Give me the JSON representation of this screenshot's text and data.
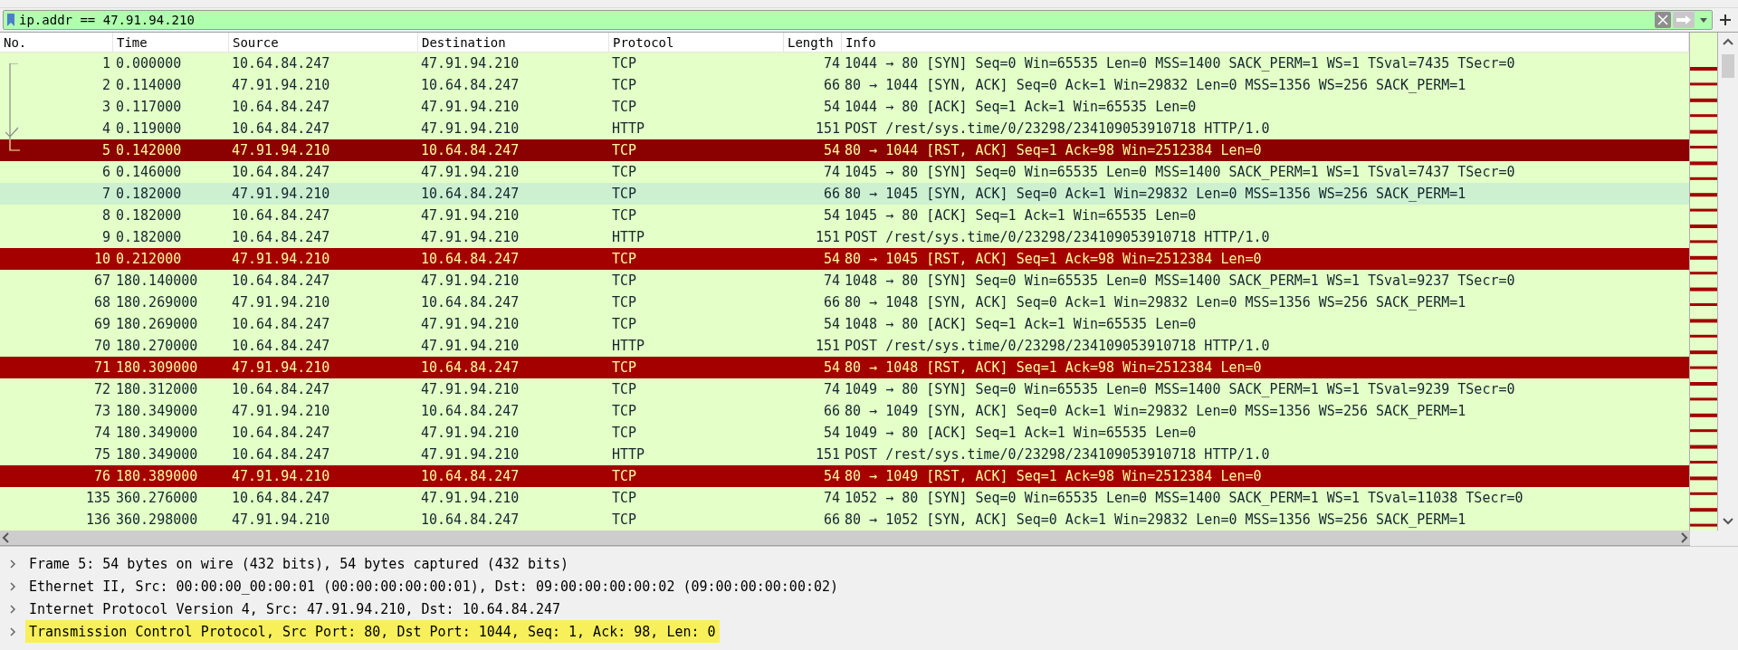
{
  "filter": {
    "value": "ip.addr == 47.91.94.210",
    "valid": true
  },
  "columns": [
    "No.",
    "Time",
    "Source",
    "Destination",
    "Protocol",
    "Length",
    "Info"
  ],
  "rows": [
    {
      "no": "1",
      "time": "0.000000",
      "source": "10.64.84.247",
      "destination": "47.91.94.210",
      "protocol": "TCP",
      "length": "74",
      "info": "1044 → 80 [SYN] Seq=0 Win=65535 Len=0 MSS=1400 SACK_PERM=1 WS=1 TSval=7435 TSecr=0",
      "kind": "normal",
      "selected": false,
      "hovered": false,
      "related": true,
      "request": false
    },
    {
      "no": "2",
      "time": "0.114000",
      "source": "47.91.94.210",
      "destination": "10.64.84.247",
      "protocol": "TCP",
      "length": "66",
      "info": "80 → 1044 [SYN, ACK] Seq=0 Ack=1 Win=29832 Len=0 MSS=1356 WS=256 SACK_PERM=1",
      "kind": "normal",
      "selected": false,
      "hovered": false,
      "related": true,
      "request": false
    },
    {
      "no": "3",
      "time": "0.117000",
      "source": "10.64.84.247",
      "destination": "47.91.94.210",
      "protocol": "TCP",
      "length": "54",
      "info": "1044 → 80 [ACK] Seq=1 Ack=1 Win=65535 Len=0",
      "kind": "normal",
      "selected": false,
      "hovered": false,
      "related": true,
      "request": false
    },
    {
      "no": "4",
      "time": "0.119000",
      "source": "10.64.84.247",
      "destination": "47.91.94.210",
      "protocol": "HTTP",
      "length": "151",
      "info": "POST /rest/sys.time/0/23298/234109053910718 HTTP/1.0",
      "kind": "normal",
      "selected": false,
      "hovered": false,
      "related": true,
      "request": true
    },
    {
      "no": "5",
      "time": "0.142000",
      "source": "47.91.94.210",
      "destination": "10.64.84.247",
      "protocol": "TCP",
      "length": "54",
      "info": "80 → 1044 [RST, ACK] Seq=1 Ack=98 Win=2512384 Len=0",
      "kind": "error",
      "selected": true,
      "hovered": false,
      "related": true,
      "request": false
    },
    {
      "no": "6",
      "time": "0.146000",
      "source": "10.64.84.247",
      "destination": "47.91.94.210",
      "protocol": "TCP",
      "length": "74",
      "info": "1045 → 80 [SYN] Seq=0 Win=65535 Len=0 MSS=1400 SACK_PERM=1 WS=1 TSval=7437 TSecr=0",
      "kind": "normal",
      "selected": false,
      "hovered": false,
      "related": false,
      "request": false
    },
    {
      "no": "7",
      "time": "0.182000",
      "source": "47.91.94.210",
      "destination": "10.64.84.247",
      "protocol": "TCP",
      "length": "66",
      "info": "80 → 1045 [SYN, ACK] Seq=0 Ack=1 Win=29832 Len=0 MSS=1356 WS=256 SACK_PERM=1",
      "kind": "normal",
      "selected": false,
      "hovered": true,
      "related": false,
      "request": false
    },
    {
      "no": "8",
      "time": "0.182000",
      "source": "10.64.84.247",
      "destination": "47.91.94.210",
      "protocol": "TCP",
      "length": "54",
      "info": "1045 → 80 [ACK] Seq=1 Ack=1 Win=65535 Len=0",
      "kind": "normal",
      "selected": false,
      "hovered": false,
      "related": false,
      "request": false
    },
    {
      "no": "9",
      "time": "0.182000",
      "source": "10.64.84.247",
      "destination": "47.91.94.210",
      "protocol": "HTTP",
      "length": "151",
      "info": "POST /rest/sys.time/0/23298/234109053910718 HTTP/1.0",
      "kind": "normal",
      "selected": false,
      "hovered": false,
      "related": false,
      "request": false
    },
    {
      "no": "10",
      "time": "0.212000",
      "source": "47.91.94.210",
      "destination": "10.64.84.247",
      "protocol": "TCP",
      "length": "54",
      "info": "80 → 1045 [RST, ACK] Seq=1 Ack=98 Win=2512384 Len=0",
      "kind": "error",
      "selected": false,
      "hovered": false,
      "related": false,
      "request": false
    },
    {
      "no": "67",
      "time": "180.140000",
      "source": "10.64.84.247",
      "destination": "47.91.94.210",
      "protocol": "TCP",
      "length": "74",
      "info": "1048 → 80 [SYN] Seq=0 Win=65535 Len=0 MSS=1400 SACK_PERM=1 WS=1 TSval=9237 TSecr=0",
      "kind": "normal",
      "selected": false,
      "hovered": false,
      "related": false,
      "request": false
    },
    {
      "no": "68",
      "time": "180.269000",
      "source": "47.91.94.210",
      "destination": "10.64.84.247",
      "protocol": "TCP",
      "length": "66",
      "info": "80 → 1048 [SYN, ACK] Seq=0 Ack=1 Win=29832 Len=0 MSS=1356 WS=256 SACK_PERM=1",
      "kind": "normal",
      "selected": false,
      "hovered": false,
      "related": false,
      "request": false
    },
    {
      "no": "69",
      "time": "180.269000",
      "source": "10.64.84.247",
      "destination": "47.91.94.210",
      "protocol": "TCP",
      "length": "54",
      "info": "1048 → 80 [ACK] Seq=1 Ack=1 Win=65535 Len=0",
      "kind": "normal",
      "selected": false,
      "hovered": false,
      "related": false,
      "request": false
    },
    {
      "no": "70",
      "time": "180.270000",
      "source": "10.64.84.247",
      "destination": "47.91.94.210",
      "protocol": "HTTP",
      "length": "151",
      "info": "POST /rest/sys.time/0/23298/234109053910718 HTTP/1.0",
      "kind": "normal",
      "selected": false,
      "hovered": false,
      "related": false,
      "request": false
    },
    {
      "no": "71",
      "time": "180.309000",
      "source": "47.91.94.210",
      "destination": "10.64.84.247",
      "protocol": "TCP",
      "length": "54",
      "info": "80 → 1048 [RST, ACK] Seq=1 Ack=98 Win=2512384 Len=0",
      "kind": "error",
      "selected": false,
      "hovered": false,
      "related": false,
      "request": false
    },
    {
      "no": "72",
      "time": "180.312000",
      "source": "10.64.84.247",
      "destination": "47.91.94.210",
      "protocol": "TCP",
      "length": "74",
      "info": "1049 → 80 [SYN] Seq=0 Win=65535 Len=0 MSS=1400 SACK_PERM=1 WS=1 TSval=9239 TSecr=0",
      "kind": "normal",
      "selected": false,
      "hovered": false,
      "related": false,
      "request": false
    },
    {
      "no": "73",
      "time": "180.349000",
      "source": "47.91.94.210",
      "destination": "10.64.84.247",
      "protocol": "TCP",
      "length": "66",
      "info": "80 → 1049 [SYN, ACK] Seq=0 Ack=1 Win=29832 Len=0 MSS=1356 WS=256 SACK_PERM=1",
      "kind": "normal",
      "selected": false,
      "hovered": false,
      "related": false,
      "request": false
    },
    {
      "no": "74",
      "time": "180.349000",
      "source": "10.64.84.247",
      "destination": "47.91.94.210",
      "protocol": "TCP",
      "length": "54",
      "info": "1049 → 80 [ACK] Seq=1 Ack=1 Win=65535 Len=0",
      "kind": "normal",
      "selected": false,
      "hovered": false,
      "related": false,
      "request": false
    },
    {
      "no": "75",
      "time": "180.349000",
      "source": "10.64.84.247",
      "destination": "47.91.94.210",
      "protocol": "HTTP",
      "length": "151",
      "info": "POST /rest/sys.time/0/23298/234109053910718 HTTP/1.0",
      "kind": "normal",
      "selected": false,
      "hovered": false,
      "related": false,
      "request": false
    },
    {
      "no": "76",
      "time": "180.389000",
      "source": "47.91.94.210",
      "destination": "10.64.84.247",
      "protocol": "TCP",
      "length": "54",
      "info": "80 → 1049 [RST, ACK] Seq=1 Ack=98 Win=2512384 Len=0",
      "kind": "error",
      "selected": false,
      "hovered": false,
      "related": false,
      "request": false
    },
    {
      "no": "135",
      "time": "360.276000",
      "source": "10.64.84.247",
      "destination": "47.91.94.210",
      "protocol": "TCP",
      "length": "74",
      "info": "1052 → 80 [SYN] Seq=0 Win=65535 Len=0 MSS=1400 SACK_PERM=1 WS=1 TSval=11038 TSecr=0",
      "kind": "normal",
      "selected": false,
      "hovered": false,
      "related": false,
      "request": false
    },
    {
      "no": "136",
      "time": "360.298000",
      "source": "47.91.94.210",
      "destination": "10.64.84.247",
      "protocol": "TCP",
      "length": "66",
      "info": "80 → 1052 [SYN, ACK] Seq=0 Ack=1 Win=29832 Len=0 MSS=1356 WS=256 SACK_PERM=1",
      "kind": "normal",
      "selected": false,
      "hovered": false,
      "related": false,
      "request": false
    }
  ],
  "details": [
    {
      "text": "Frame 5: 54 bytes on wire (432 bits), 54 bytes captured (432 bits)",
      "expanded": false,
      "selected": false
    },
    {
      "text": "Ethernet II, Src: 00:00:00_00:00:01 (00:00:00:00:00:01), Dst: 09:00:00:00:00:02 (09:00:00:00:00:02)",
      "expanded": false,
      "selected": false
    },
    {
      "text": "Internet Protocol Version 4, Src: 47.91.94.210, Dst: 10.64.84.247",
      "expanded": false,
      "selected": false
    },
    {
      "text": "Transmission Control Protocol, Src Port: 80, Dst Port: 1044, Seq: 1, Ack: 98, Len: 0",
      "expanded": false,
      "selected": true
    }
  ]
}
